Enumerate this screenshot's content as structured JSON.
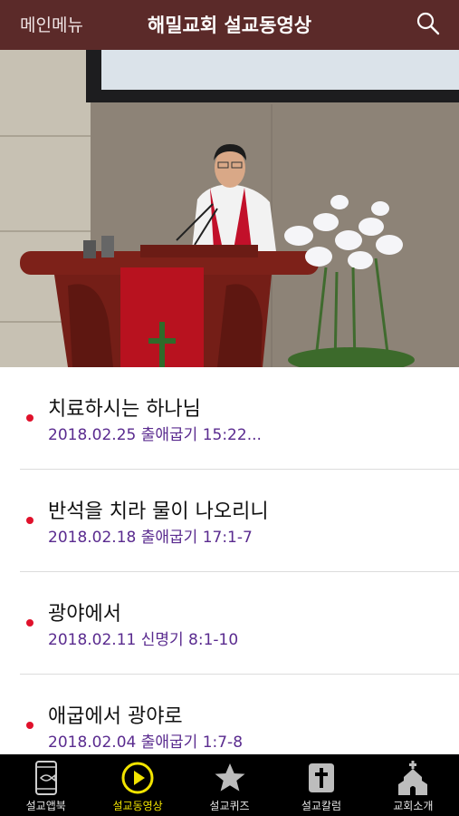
{
  "header": {
    "menu_label": "메인메뉴",
    "title": "해밀교회 설교동영상",
    "search_icon": "search-icon"
  },
  "sermons": [
    {
      "title": "치료하시는 하나님",
      "subtitle": "2018.02.25 출애굽기 15:22..."
    },
    {
      "title": "반석을 치라 물이 나오리니",
      "subtitle": "2018.02.18 출애굽기 17:1-7"
    },
    {
      "title": "광야에서",
      "subtitle": "2018.02.11 신명기 8:1-10"
    },
    {
      "title": "애굽에서 광야로",
      "subtitle": "2018.02.04 출애굽기 1:7-8"
    }
  ],
  "tabs": [
    {
      "label": "설교앱북",
      "icon": "phone-fish-icon"
    },
    {
      "label": "설교동영상",
      "icon": "play-circle-icon",
      "active": true
    },
    {
      "label": "설교퀴즈",
      "icon": "star-icon"
    },
    {
      "label": "설교칼럼",
      "icon": "cross-scroll-icon"
    },
    {
      "label": "교회소개",
      "icon": "church-icon"
    }
  ],
  "colors": {
    "header_bg": "#5b2a29",
    "accent_subtitle": "#5a2b8f",
    "bullet": "#e0112b",
    "tab_active": "#f2e400",
    "tabbar_bg": "#000000"
  }
}
